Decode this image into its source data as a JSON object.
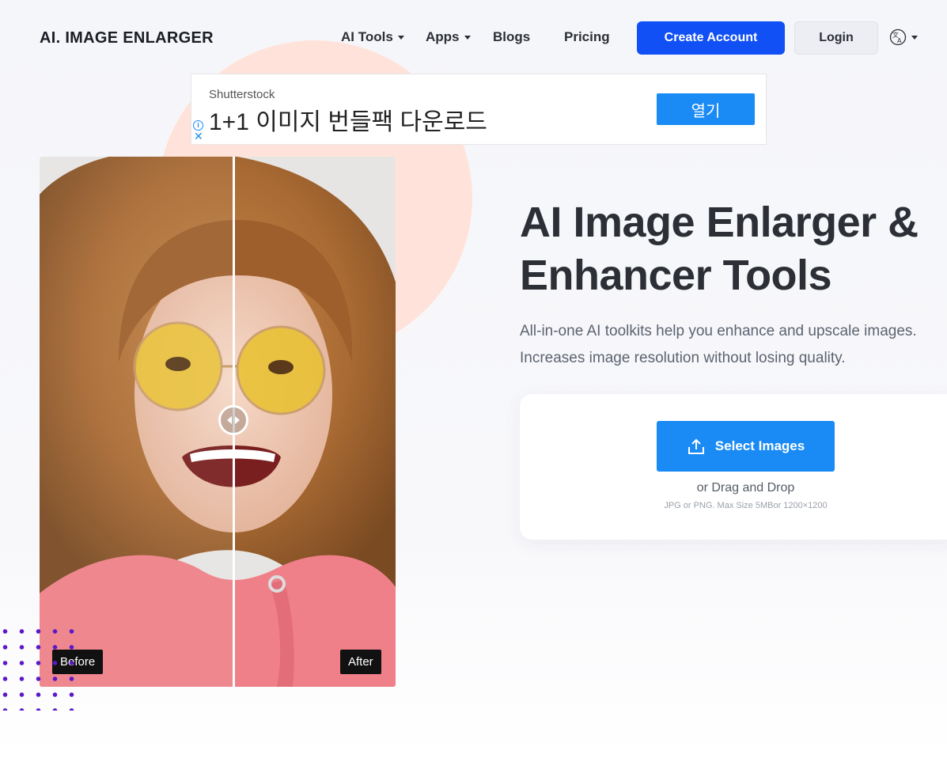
{
  "header": {
    "logo": "AI. IMAGE ENLARGER",
    "nav": [
      {
        "label": "AI Tools",
        "dropdown": true
      },
      {
        "label": "Apps",
        "dropdown": true
      },
      {
        "label": "Blogs",
        "dropdown": false
      },
      {
        "label": "Pricing",
        "dropdown": false
      }
    ],
    "create_account": "Create Account",
    "login": "Login",
    "language_icon": "translate-icon"
  },
  "ad": {
    "source": "Shutterstock",
    "title": "1+1 이미지 번들팩 다운로드",
    "button": "열기"
  },
  "comparison": {
    "before_label": "Before",
    "after_label": "After"
  },
  "hero": {
    "title_line1": "AI Image Enlarger &",
    "title_line2": "Enhancer Tools",
    "subtitle_line1": "All-in-one AI toolkits help you enhance and upscale images.",
    "subtitle_line2": "Increases image resolution without losing quality."
  },
  "upload": {
    "button": "Select Images",
    "drag_text": "or Drag and Drop",
    "hint": "JPG or PNG. Max Size 5MBor 1200×1200"
  },
  "colors": {
    "primary": "#1150f5",
    "accent_blue": "#1a8bf5",
    "blob": "#ffe3da",
    "dots": "#5b18c9"
  }
}
